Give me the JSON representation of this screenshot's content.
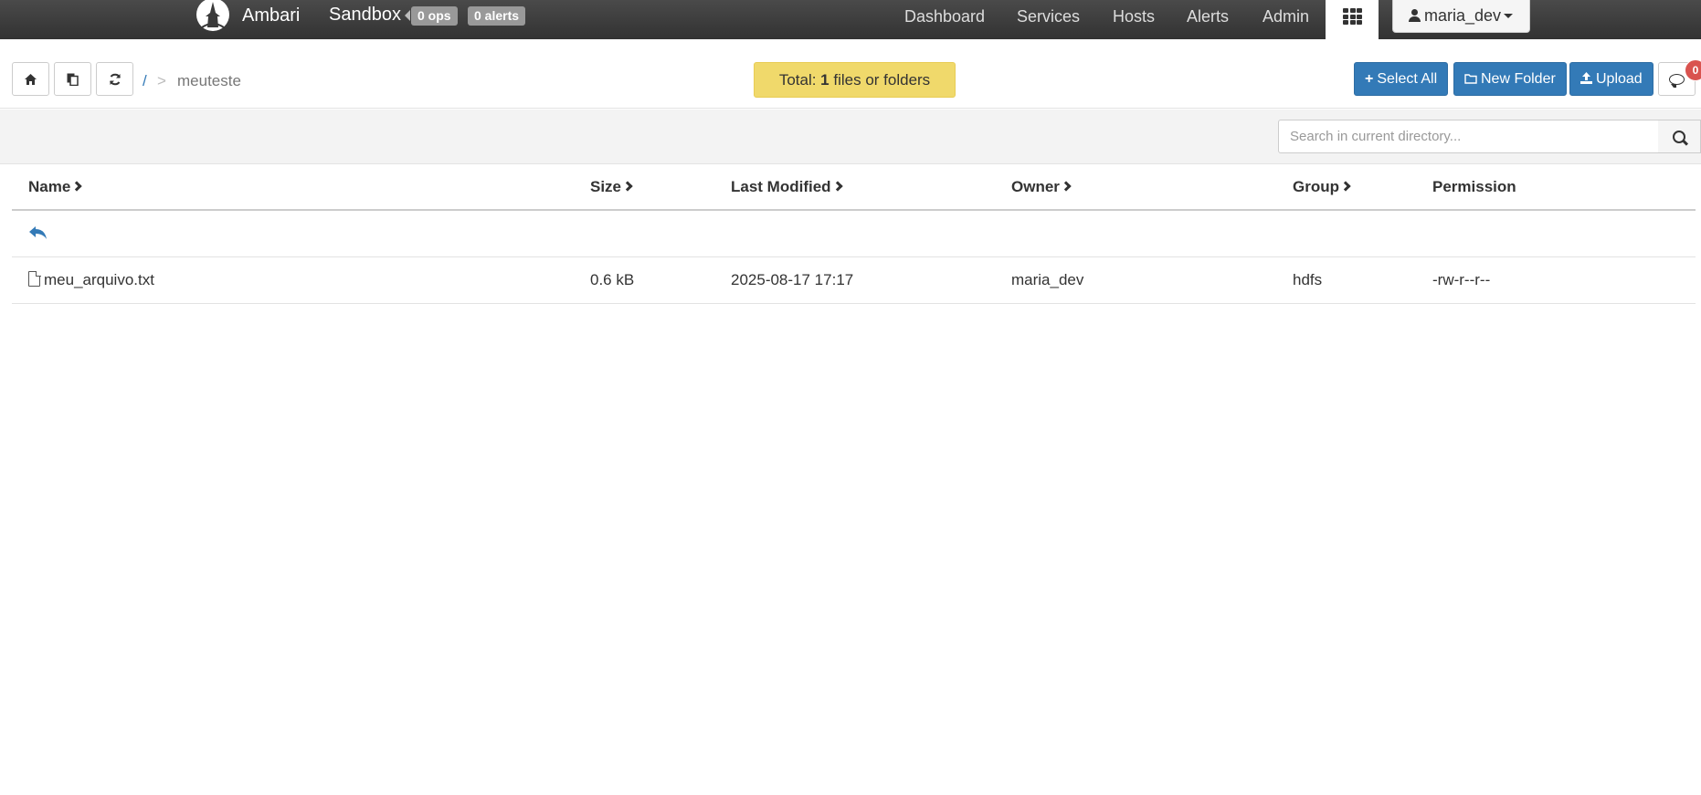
{
  "navbar": {
    "brand": "Ambari",
    "cluster": "Sandbox",
    "ops_badge": "0 ops",
    "alerts_badge": "0 alerts",
    "links": [
      "Dashboard",
      "Services",
      "Hosts",
      "Alerts",
      "Admin"
    ],
    "user": "maria_dev"
  },
  "toolbar": {
    "breadcrumb_root": "/",
    "breadcrumb_sep": ">",
    "breadcrumb_current": "meuteste",
    "total_prefix": "Total: ",
    "total_count": "1",
    "total_suffix": " files or folders",
    "select_all": "Select All",
    "new_folder": "New Folder",
    "upload": "Upload",
    "notifications_count": "0"
  },
  "search": {
    "placeholder": "Search in current directory..."
  },
  "table": {
    "headers": {
      "name": "Name",
      "size": "Size",
      "last_modified": "Last Modified",
      "owner": "Owner",
      "group": "Group",
      "permission": "Permission"
    },
    "rows": [
      {
        "name": "meu_arquivo.txt",
        "size": "0.6 kB",
        "last_modified": "2025-08-17 17:17",
        "owner": "maria_dev",
        "group": "hdfs",
        "permission": "-rw-r--r--"
      }
    ]
  },
  "colors": {
    "navbar": "#3a3a3a",
    "primary": "#337ab7",
    "total_highlight": "#f0d96b",
    "danger_badge": "#d9534f"
  }
}
